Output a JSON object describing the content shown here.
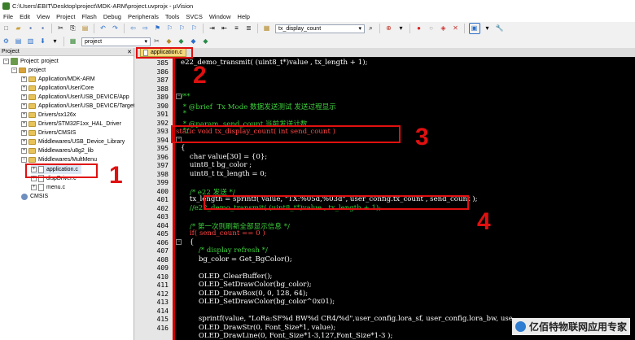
{
  "window": {
    "title": "C:\\Users\\EBIT\\Desktop\\project\\MDK-ARM\\project.uvprojx - µVision"
  },
  "menu": [
    "File",
    "Edit",
    "View",
    "Project",
    "Flash",
    "Debug",
    "Peripherals",
    "Tools",
    "SVCS",
    "Window",
    "Help"
  ],
  "toolbar": {
    "function_combo": "tx_display_count",
    "target_combo": "project"
  },
  "project_pane": {
    "header": "Project",
    "root": "Project: project",
    "target": "project",
    "groups": [
      "Application/MDK-ARM",
      "Application/User/Core",
      "Application/User/USB_DEVICE/App",
      "Application/User/USB_DEVICE/Target",
      "Drivers/sx126x",
      "Drivers/STM32F1xx_HAL_Driver",
      "Drivers/CMSIS",
      "Middlewares/USB_Device_Library",
      "Middlewares/u8g2_lib",
      "Middlewares/MultMenu"
    ],
    "files": [
      "application.c",
      "dispDriver.c",
      "menu.c"
    ],
    "cmsis": "CMSIS"
  },
  "editor": {
    "tab_label": "application.c",
    "line_numbers": [
      "385",
      "386",
      "387",
      "388",
      "389",
      "390",
      "391",
      "392",
      "393",
      "394",
      "395",
      "396",
      "397",
      "398",
      "399",
      "400",
      "401",
      "402",
      "403",
      "404",
      "405",
      "406",
      "407",
      "408",
      "409",
      "410",
      "411",
      "412",
      "413",
      "414",
      "415",
      "416"
    ],
    "lines": {
      "l385": "e22_demo_transmit( (uint8_t*)value , tx_length + 1);",
      "l388": "/**",
      "l389": " * @brief  Tx Mode 数据发送测试 发送过程显示",
      "l390": " *",
      "l391": " * @param  send_count 当前发送计数",
      "l392": " */",
      "l393": "static void tx_display_count( int send_count )",
      "l394": "{",
      "l395": "    char value[30] = {0};",
      "l396": "    uint8_t bg_color ;",
      "l397": "    uint8_t tx_length = 0;",
      "l399": "    /* e22 发送 */",
      "l400": "    tx_length = sprintf( value, \"TX:%05d,%03d\", user_config.tx_count , send_count );",
      "l401": "    //e22_demo_transmit( (uint8_t*)value , tx_length + 1);",
      "l403": "    /* 第一次则刷新全部显示信息 */",
      "l404": "    if( send_count == 0 )",
      "l405": "    {",
      "l406": "        /* display refresh */",
      "l407": "        bg_color = Get_BgColor();",
      "l409": "        OLED_ClearBuffer();",
      "l410": "        OLED_SetDrawColor(bg_color);",
      "l411": "        OLED_DrawBox(0, 0, 128, 64);",
      "l412": "        OLED_SetDrawColor(bg_color^0x01);",
      "l414": "        sprintf(value, \"LoRa:SF%d BW%d CR4/%d\",user_config.lora_sf, user_config.lora_bw, use",
      "l415": "        OLED_DrawStr(0, Font_Size*1, value);",
      "l416": "        OLED_DrawLine(0, Font_Size*1-3,127,Font_Size*1-3 );"
    }
  },
  "annotations": {
    "n1": "1",
    "n2": "2",
    "n3": "3",
    "n4": "4"
  },
  "watermark": "亿佰特物联网应用专家",
  "colors": {
    "annotation_red": "#e01010",
    "editor_bg": "#000000",
    "comment": "#3dd13d",
    "keyword": "#ff4444",
    "string": "#ff77ff"
  }
}
